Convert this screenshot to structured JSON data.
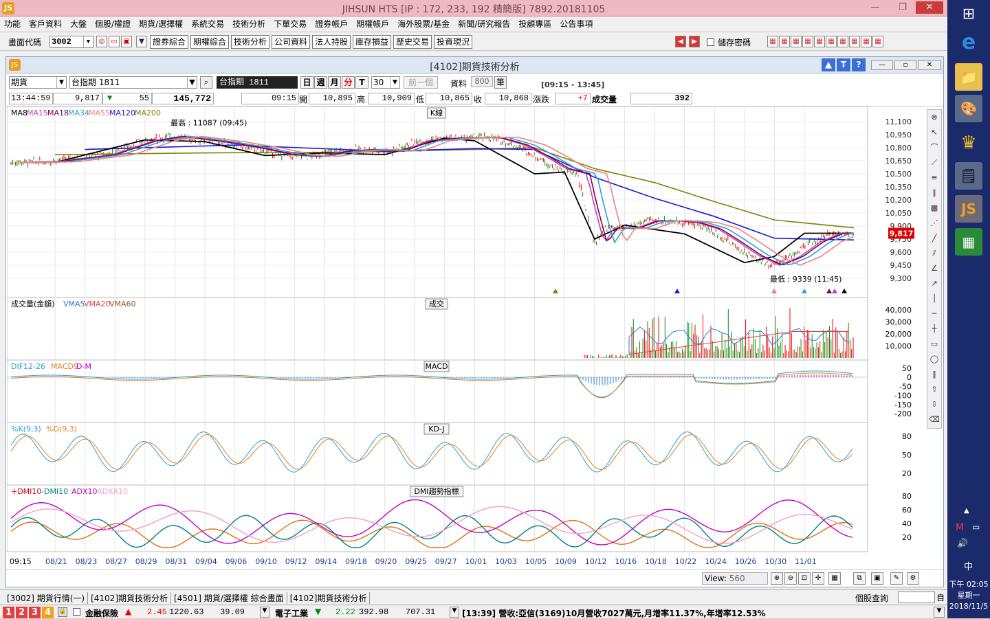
{
  "window": {
    "title": "JIHSUN HTS     [IP : 172, 233, 192 精簡版] 7892.20181105",
    "logo": "JS"
  },
  "menu": [
    "功能",
    "客戶資料",
    "大盤",
    "個股/權證",
    "期貨/選擇權",
    "系統交易",
    "技術分析",
    "下單交易",
    "證券帳戶",
    "期權帳戶",
    "海外股票/基金",
    "新聞/研究報告",
    "投顧專區",
    "公告事項"
  ],
  "toolbar": {
    "code_label": "畫面代碼",
    "code_value": "3002",
    "buttons": [
      "證券綜合",
      "期權綜合",
      "技術分析",
      "公司資料",
      "法人持股",
      "庫存損益",
      "歷史交易",
      "投資現況"
    ],
    "save_pwd_label": "儲存密碼"
  },
  "chart_window": {
    "title": "[4102]期貨技術分析",
    "product_type": "期貨",
    "contract": "台指期 1811",
    "contract_display": "台指期 1811",
    "periods": [
      "日",
      "週",
      "月",
      "分",
      "T"
    ],
    "interval": "30",
    "prev_btn": "前一個",
    "data_label": "資料",
    "data_count": "800",
    "bar_unit": "筆",
    "session": "[09:15 - 13:45]"
  },
  "quote": {
    "time": "13:44:59",
    "price": "9,817",
    "change": "55",
    "volume": "145,772",
    "bar_time": "09:15",
    "open_label": "開",
    "open": "10,895",
    "high_label": "高",
    "high": "10,909",
    "low_label": "低",
    "low": "10,865",
    "close_label": "收",
    "close": "10,868",
    "chg_label": "漲跌",
    "chg": "+7",
    "vol_label": "成交量",
    "vol": "392"
  },
  "panels": {
    "k": {
      "title": "K線",
      "legend": [
        "MA8",
        "MA15",
        "MA18",
        "MA34",
        "MA55",
        "MA120",
        "MA200"
      ],
      "high_note": "最高 : 11087 (09:45)",
      "low_note": "最低 : 9339 (11:45)",
      "yticks": [
        "11,100",
        "10,950",
        "10,800",
        "10,650",
        "10,500",
        "10,350",
        "10,200",
        "10,050",
        "9,900",
        "9,750",
        "9,600",
        "9,450",
        "9,300"
      ],
      "last_price": "9,817"
    },
    "vol": {
      "title": "成交",
      "legend": [
        "成交量(金額)",
        "VMA5",
        "VMA20",
        "VMA60"
      ],
      "yticks": [
        "40,000",
        "30,000",
        "20,000",
        "10,000"
      ]
    },
    "macd": {
      "title": "MACD",
      "legend": [
        "DIF12-26",
        "MACD9",
        "D-M"
      ],
      "yticks": [
        "50",
        "0",
        "-50",
        "-100",
        "-150",
        "-200"
      ]
    },
    "kd": {
      "title": "KD-J",
      "legend": [
        "%K(9,3)",
        "%D(9,3)"
      ],
      "yticks": [
        "80",
        "50",
        "20"
      ]
    },
    "dmi": {
      "title": "DMI趨勢指標",
      "legend": [
        "+DMI10",
        "-DMI10",
        "ADX10",
        "ADXR10"
      ],
      "yticks": [
        "80",
        "60",
        "40",
        "20"
      ]
    }
  },
  "xaxis": [
    "09:15",
    "08/21",
    "08/23",
    "08/27",
    "08/29",
    "08/31",
    "09/04",
    "09/06",
    "09/10",
    "09/12",
    "09/14",
    "09/18",
    "09/20",
    "09/25",
    "09/27",
    "10/01",
    "10/03",
    "10/05",
    "10/09",
    "10/12",
    "10/16",
    "10/18",
    "10/22",
    "10/24",
    "10/26",
    "10/30",
    "11/01"
  ],
  "view": {
    "label": "View:",
    "value": "560"
  },
  "tabs": [
    "[3002] 期貨行情(一)",
    "[4102]期貨技術分析",
    "[4501] 期貨/選擇權 綜合畫面",
    "[4102]期貨技術分析"
  ],
  "stock_query": "個股查詢",
  "status": {
    "nums": [
      "1",
      "2",
      "3",
      "4"
    ],
    "sector1": "金融保險",
    "s1_chg": "2.45",
    "s1_idx": "1220.63",
    "s1_val": "39.09",
    "sector2": "電子工業",
    "s2_chg": "2.22",
    "s2_idx": "392.98",
    "s2_val": "707.31",
    "news": "[13:39] 營收:亞信(3169)10月營收7027萬元,月增率11.37%,年增率12.53%"
  },
  "taskbar": {
    "time": "下午 02:05",
    "weekday": "星期一",
    "date": "2018/11/5",
    "ime": "中"
  },
  "colors": {
    "ma8": "#000000",
    "ma15": "#c040c0",
    "ma18": "#800040",
    "ma34": "#2aa0d8",
    "ma55": "#f08080",
    "ma120": "#1818d8",
    "ma200": "#808000",
    "accent": "#e00000"
  },
  "chart_data": [
    {
      "type": "line",
      "title": "K線",
      "series": [
        {
          "name": "MA200",
          "x": [
            "08/21",
            "09/04",
            "09/18",
            "10/01",
            "10/05",
            "10/12",
            "10/18",
            "10/24",
            "10/30",
            "11/01"
          ],
          "values": [
            10720,
            10740,
            10750,
            10780,
            10800,
            10560,
            10400,
            10180,
            9970,
            9880
          ]
        },
        {
          "name": "MA120",
          "x": [
            "08/23",
            "09/06",
            "09/20",
            "10/01",
            "10/05",
            "10/12",
            "10/18",
            "10/24",
            "10/30",
            "11/01"
          ],
          "values": [
            10780,
            10830,
            10760,
            10790,
            10780,
            10460,
            10220,
            10010,
            9760,
            9740
          ]
        },
        {
          "name": "MA8",
          "x": [
            "08/21",
            "08/29",
            "09/04",
            "09/10",
            "09/14",
            "09/20",
            "09/27",
            "10/01",
            "10/05",
            "10/09",
            "10/12",
            "10/16",
            "10/22",
            "10/26",
            "10/30",
            "11/01"
          ],
          "values": [
            10630,
            10890,
            10870,
            10710,
            10740,
            10720,
            10910,
            10880,
            10500,
            10520,
            9750,
            9910,
            9810,
            9480,
            9550,
            9817
          ]
        }
      ],
      "ylim": [
        9250,
        11200
      ]
    }
  ]
}
